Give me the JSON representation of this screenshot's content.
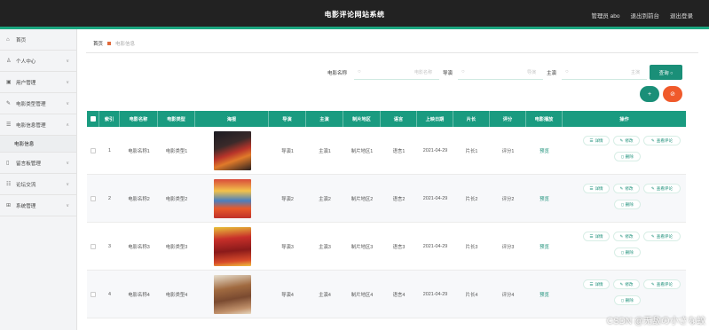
{
  "header": {
    "title": "电影评论网站系统",
    "user_label": "管理员 abo",
    "back_label": "退出到前台",
    "logout_label": "退出登录"
  },
  "sidebar": {
    "items": [
      {
        "label": "首页",
        "icon": "home-icon",
        "glyph": "⌂"
      },
      {
        "label": "个人中心",
        "icon": "user-icon",
        "glyph": "♙"
      },
      {
        "label": "用户管理",
        "icon": "users-icon",
        "glyph": "▣"
      },
      {
        "label": "电影类型管理",
        "icon": "tag-icon",
        "glyph": "✎"
      },
      {
        "label": "电影信息管理",
        "icon": "film-icon",
        "glyph": "☰"
      },
      {
        "label": "电影信息",
        "icon": "",
        "glyph": ""
      },
      {
        "label": "留言板管理",
        "icon": "message-icon",
        "glyph": "▯"
      },
      {
        "label": "论坛交流",
        "icon": "forum-icon",
        "glyph": "☷"
      },
      {
        "label": "系统管理",
        "icon": "settings-icon",
        "glyph": "⊞"
      }
    ]
  },
  "breadcrumb": {
    "home": "首页",
    "current": "电影信息"
  },
  "search": {
    "name_label": "电影名称",
    "name_placeholder": "电影名称",
    "director_label": "导演",
    "director_placeholder": "导演",
    "actor_label": "主演",
    "actor_placeholder": "主演",
    "query_label": "查询 ○"
  },
  "actions": {
    "add_glyph": "+",
    "delete_glyph": "⊘"
  },
  "table": {
    "headers": [
      "索引",
      "电影名称",
      "电影类型",
      "海报",
      "导演",
      "主演",
      "制片地区",
      "语言",
      "上映日期",
      "片长",
      "评分",
      "电影播放",
      "操作"
    ],
    "rows": [
      {
        "index": "1",
        "name": "电影名称1",
        "type": "电影类型1",
        "director": "导演1",
        "actor": "主演1",
        "region": "制片地区1",
        "language": "语言1",
        "date": "2021-04-29",
        "length": "片长1",
        "score": "评分1",
        "play": "预览"
      },
      {
        "index": "2",
        "name": "电影名称2",
        "type": "电影类型2",
        "director": "导演2",
        "actor": "主演2",
        "region": "制片地区2",
        "language": "语言2",
        "date": "2021-04-29",
        "length": "片长2",
        "score": "评分2",
        "play": "预览"
      },
      {
        "index": "3",
        "name": "电影名称3",
        "type": "电影类型3",
        "director": "导演3",
        "actor": "主演3",
        "region": "制片地区3",
        "language": "语言3",
        "date": "2021-04-29",
        "length": "片长3",
        "score": "评分3",
        "play": "预览"
      },
      {
        "index": "4",
        "name": "电影名称4",
        "type": "电影类型4",
        "director": "导演4",
        "actor": "主演4",
        "region": "制片地区4",
        "language": "语言4",
        "date": "2021-04-29",
        "length": "片长4",
        "score": "评分4",
        "play": "预览"
      }
    ],
    "row_actions": {
      "detail": "详情",
      "edit": "修改",
      "comments": "查看评论",
      "delete": "删除"
    }
  },
  "colors": {
    "accent": "#1a9b80",
    "danger": "#f05a2b",
    "topbar": "#222222"
  },
  "watermark": "CSDN @无敌の小さな蚊"
}
